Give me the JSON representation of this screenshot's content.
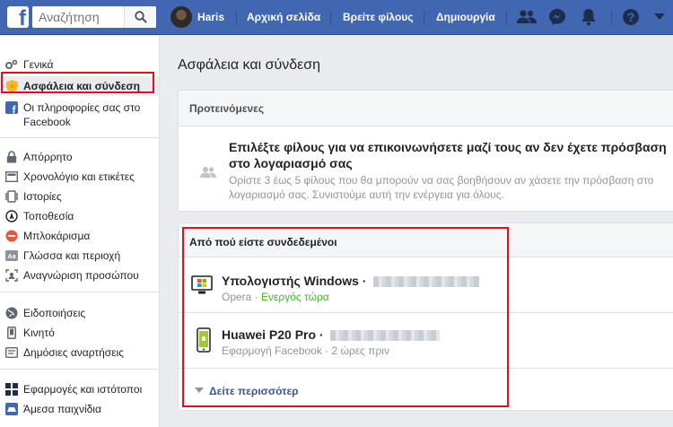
{
  "topbar": {
    "logo": "f",
    "search_placeholder": "Αναζήτηση",
    "user_name": "Haris",
    "links": [
      "Αρχική σελίδα",
      "Βρείτε φίλους",
      "Δημιουργία"
    ],
    "icons": [
      "friend-requests-icon",
      "messenger-icon",
      "notifications-icon",
      "help-icon",
      "dropdown-icon"
    ],
    "color": "#4267b2"
  },
  "sidebar": {
    "groups": [
      [
        {
          "label": "Γενικά",
          "icon": "gear-icon"
        },
        {
          "label": "Ασφάλεια και σύνδεση",
          "icon": "shield-icon",
          "active": true
        },
        {
          "label": "Οι πληροφορίες σας στο Facebook",
          "icon": "facebook-icon"
        }
      ],
      [
        {
          "label": "Απόρρητο",
          "icon": "lock-icon"
        },
        {
          "label": "Χρονολόγιο και ετικέτες",
          "icon": "timeline-icon"
        },
        {
          "label": "Ιστορίες",
          "icon": "stories-icon"
        },
        {
          "label": "Τοποθεσία",
          "icon": "location-icon"
        },
        {
          "label": "Μπλοκάρισμα",
          "icon": "block-icon"
        },
        {
          "label": "Γλώσσα και περιοχή",
          "icon": "language-icon"
        },
        {
          "label": "Αναγνώριση προσώπου",
          "icon": "face-recognition-icon"
        }
      ],
      [
        {
          "label": "Ειδοποιήσεις",
          "icon": "globe-icon"
        },
        {
          "label": "Κινητό",
          "icon": "mobile-icon"
        },
        {
          "label": "Δημόσιες αναρτήσεις",
          "icon": "public-posts-icon"
        }
      ],
      [
        {
          "label": "Εφαρμογές και ιστότοποι",
          "icon": "apps-icon"
        },
        {
          "label": "Άμεσα παιχνίδια",
          "icon": "games-icon"
        }
      ]
    ]
  },
  "main": {
    "title": "Ασφάλεια και σύνδεση",
    "recommended": {
      "header": "Προτεινόμενες",
      "title": "Επιλέξτε φίλους για να επικοινωνήσετε μαζί τους αν δεν έχετε πρόσβαση στο λογαριασμό σας",
      "description": "Ορίστε 3 έως 5 φίλους που θα μπορούν να σας βοηθήσουν αν χάσετε την πρόσβαση στο λογαριασμό σας. Συνιστούμε αυτή την ενέργεια για όλους."
    },
    "logins": {
      "header": "Από πού είστε συνδεδεμένοι",
      "devices": [
        {
          "name": "Υπολογιστής Windows ·",
          "app": "Opera",
          "sep": " · ",
          "status": "Ενεργός τώρα",
          "icon": "windows-pc-icon"
        },
        {
          "name": "Huawei P20 Pro ·",
          "app": "Εφαρμογή Facebook",
          "sep": " · ",
          "status": "2 ώρες πριν",
          "icon": "android-phone-icon"
        }
      ],
      "see_more": "Δείτε περισσότερ"
    }
  }
}
